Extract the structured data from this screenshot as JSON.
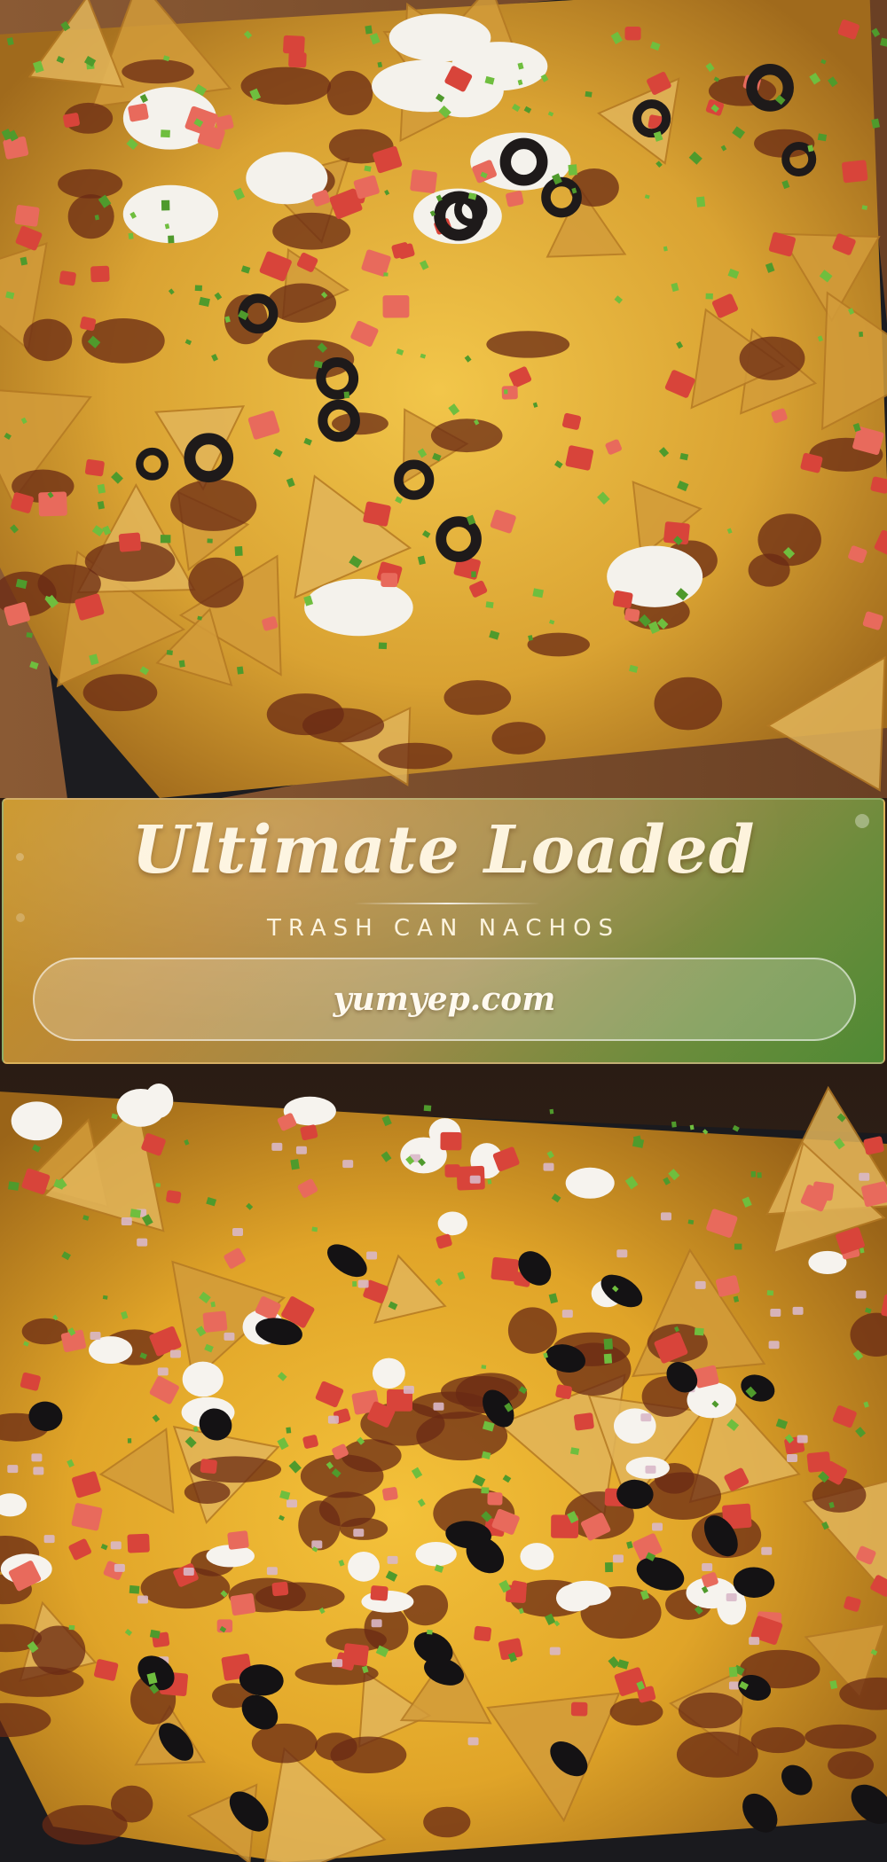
{
  "banner": {
    "title": "Ultimate Loaded",
    "subtitle": "TRASH CAN NACHOS",
    "website": "yumyep.com"
  },
  "images": {
    "top": {
      "subject": "nachos-with-sour-cream-olives-tomatoes"
    },
    "bottom": {
      "subject": "nachos-with-chili-cheese-black-beans-cotija"
    }
  },
  "colors": {
    "banner_gradient_start": "#c8901e",
    "banner_gradient_end": "#4f8a34",
    "text": "#fdf3dc",
    "cheese": "#e8b83a",
    "tomato": "#d8443a",
    "cilantro": "#4f9a2c",
    "sour_cream": "#f4f2ec",
    "olive": "#1e1a1a",
    "chili": "#6a2a14",
    "tray": "#1a1a1e",
    "wood": "#7a5030"
  }
}
